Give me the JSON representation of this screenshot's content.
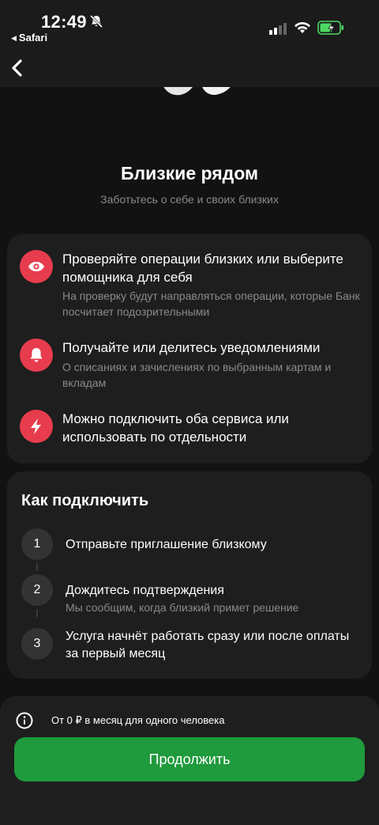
{
  "status_bar": {
    "time": "12:49",
    "back_app_label": "Safari",
    "icons": [
      "bell-off-icon",
      "signal-icon",
      "wifi-icon",
      "battery-charging-icon"
    ]
  },
  "header": {
    "title": "Близкие рядом",
    "subtitle": "Заботьтесь о себе и своих близких"
  },
  "features": [
    {
      "icon": "eye-icon",
      "title": "Проверяйте операции близких или выберите помощника для себя",
      "description": "На проверку будут направляться операции, которые Банк посчитает подозрительными"
    },
    {
      "icon": "bell-icon",
      "title": "Получайте или делитесь уведомлениями",
      "description": "О списаниях и зачислениях по выбранным картам и вкладам"
    },
    {
      "icon": "lightning-icon",
      "title": "Можно подключить оба сервиса или использовать по отдельности",
      "description": ""
    }
  ],
  "how_to": {
    "title": "Как подключить",
    "steps": [
      {
        "number": "1",
        "title": "Отправьте приглашение близкому",
        "description": ""
      },
      {
        "number": "2",
        "title": "Дождитесь подтверждения",
        "description": "Мы сообщим, когда близкий примет решение"
      },
      {
        "number": "3",
        "title": "Услуга начнёт работать сразу или после оплаты за первый месяц",
        "description": ""
      }
    ]
  },
  "footer": {
    "price_text": "От 0 ₽ в месяц для одного человека",
    "continue_label": "Продолжить"
  },
  "colors": {
    "accent_red": "#e73c4d",
    "button_green": "#1f9a3c",
    "battery_green": "#4cd964"
  }
}
